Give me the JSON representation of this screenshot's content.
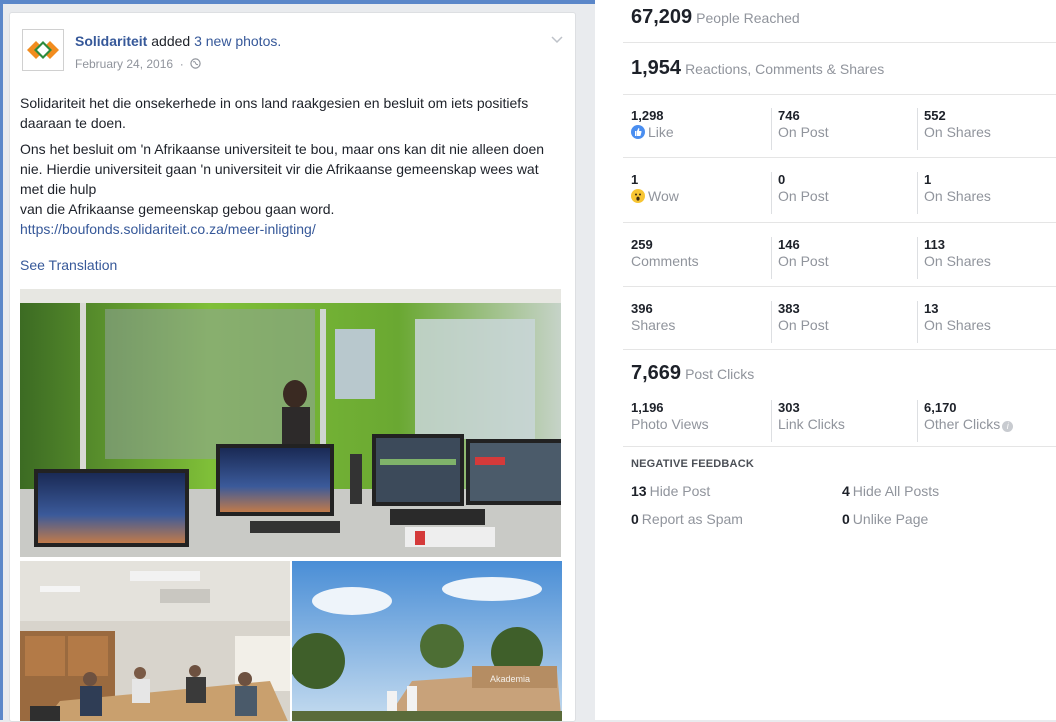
{
  "post": {
    "author": "Solidariteit",
    "action_pre": "added",
    "action_link": "3 new photos.",
    "date": "February 24, 2016",
    "paragraph1": "Solidariteit het die onsekerhede in ons land raakgesien en besluit om iets positiefs daaraan te doen.",
    "paragraph2_line1": "Ons het besluit om 'n Afrikaanse universiteit te bou, maar ons kan dit nie alleen doen nie. Hierdie universiteit gaan 'n universiteit vir die Afrikaanse gemeenskap wees wat met die hulp",
    "paragraph2_line2": "van die Afrikaanse gemeenskap gebou gaan word.",
    "link": "https://boufonds.solidariteit.co.za/meer-inligting/",
    "see_translation": "See Translation",
    "photo_sign": "Akademia"
  },
  "insights": {
    "reach": {
      "value": "67,209",
      "label": "People Reached"
    },
    "engagement": {
      "value": "1,954",
      "label": "Reactions, Comments & Shares"
    },
    "rows": [
      {
        "total": "1,298",
        "total_label": "Like",
        "icon": "like-icon",
        "post": "746",
        "post_label": "On Post",
        "shares": "552",
        "shares_label": "On Shares"
      },
      {
        "total": "1",
        "total_label": "Wow",
        "icon": "wow-icon",
        "post": "0",
        "post_label": "On Post",
        "shares": "1",
        "shares_label": "On Shares"
      },
      {
        "total": "259",
        "total_label": "Comments",
        "icon": "",
        "post": "146",
        "post_label": "On Post",
        "shares": "113",
        "shares_label": "On Shares"
      },
      {
        "total": "396",
        "total_label": "Shares",
        "icon": "",
        "post": "383",
        "post_label": "On Post",
        "shares": "13",
        "shares_label": "On Shares"
      }
    ],
    "clicks": {
      "value": "7,669",
      "label": "Post Clicks"
    },
    "click_rows": [
      {
        "value": "1,196",
        "label": "Photo Views"
      },
      {
        "value": "303",
        "label": "Link Clicks"
      },
      {
        "value": "6,170",
        "label": "Other Clicks"
      }
    ],
    "negative": {
      "title": "NEGATIVE FEEDBACK",
      "hide_post": {
        "value": "13",
        "label": "Hide Post"
      },
      "hide_all": {
        "value": "4",
        "label": "Hide All Posts"
      },
      "spam": {
        "value": "0",
        "label": "Report as Spam"
      },
      "unlike": {
        "value": "0",
        "label": "Unlike Page"
      }
    }
  },
  "colors": {
    "link": "#365899",
    "muted": "#90949c",
    "like_blue": "#4a8ef0",
    "wow_yellow": "#f7c533",
    "logo_orange": "#f28c1e",
    "logo_green": "#2e8b3e"
  }
}
